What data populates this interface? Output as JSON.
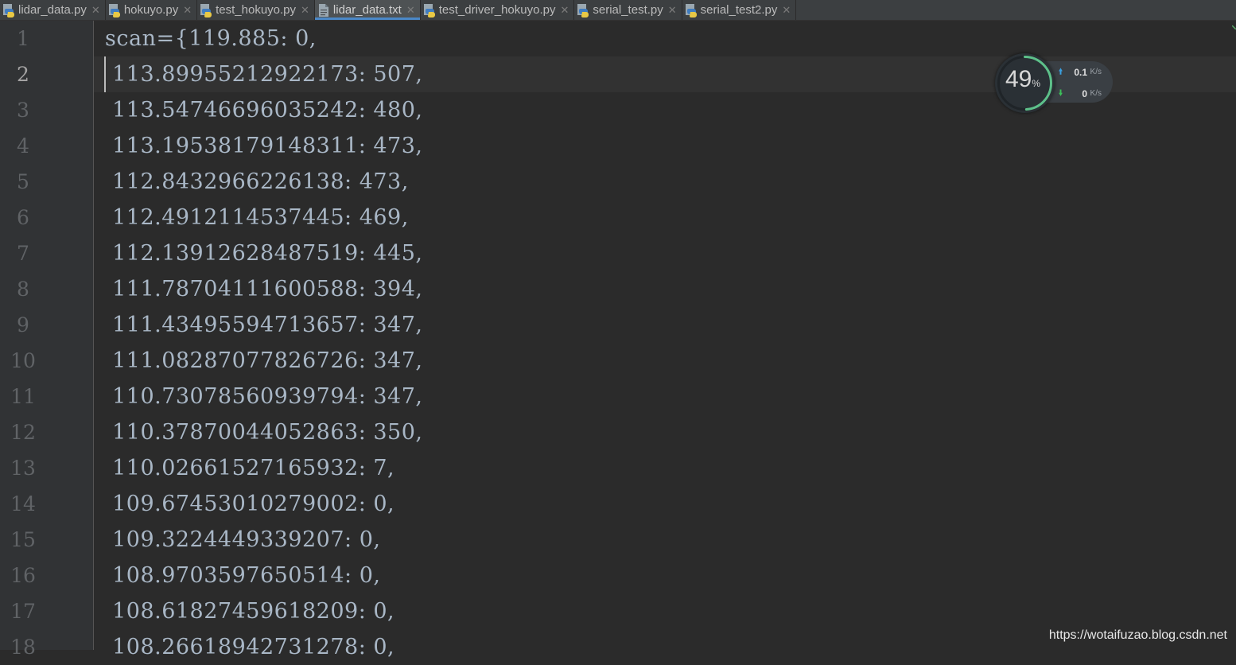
{
  "tabs": [
    {
      "label": "lidar_data.py",
      "icon": "python-file-icon",
      "active": false
    },
    {
      "label": "hokuyo.py",
      "icon": "python-file-icon",
      "active": false
    },
    {
      "label": "test_hokuyo.py",
      "icon": "python-file-icon",
      "active": false
    },
    {
      "label": "lidar_data.txt",
      "icon": "text-file-icon",
      "active": true
    },
    {
      "label": "test_driver_hokuyo.py",
      "icon": "python-file-icon",
      "active": false
    },
    {
      "label": "serial_test.py",
      "icon": "python-file-icon",
      "active": false
    },
    {
      "label": "serial_test2.py",
      "icon": "python-file-icon",
      "active": false
    }
  ],
  "editor": {
    "current_line": 2,
    "lines": [
      {
        "num": "1",
        "text": "scan={119.885: 0,"
      },
      {
        "num": "2",
        "text": " 113.89955212922173: 507,"
      },
      {
        "num": "3",
        "text": " 113.54746696035242: 480,"
      },
      {
        "num": "4",
        "text": " 113.19538179148311: 473,"
      },
      {
        "num": "5",
        "text": " 112.8432966226138: 473,"
      },
      {
        "num": "6",
        "text": " 112.4912114537445: 469,"
      },
      {
        "num": "7",
        "text": " 112.13912628487519: 445,"
      },
      {
        "num": "8",
        "text": " 111.78704111600588: 394,"
      },
      {
        "num": "9",
        "text": " 111.43495594713657: 347,"
      },
      {
        "num": "10",
        "text": " 111.08287077826726: 347,"
      },
      {
        "num": "11",
        "text": " 110.73078560939794: 347,"
      },
      {
        "num": "12",
        "text": " 110.37870044052863: 350,"
      },
      {
        "num": "13",
        "text": " 110.02661527165932: 7,"
      },
      {
        "num": "14",
        "text": " 109.67453010279002: 0,"
      },
      {
        "num": "15",
        "text": " 109.3224449339207: 0,"
      },
      {
        "num": "16",
        "text": " 108.9703597650514: 0,"
      },
      {
        "num": "17",
        "text": " 108.61827459618209: 0,"
      },
      {
        "num": "18",
        "text": " 108.26618942731278: 0,"
      }
    ]
  },
  "network_widget": {
    "percent": "49",
    "percent_unit": "%",
    "upload_value": "0.1",
    "upload_unit": "K/s",
    "download_value": "0",
    "download_unit": "K/s",
    "ring_fraction": 0.49,
    "ring_color": "#5dc08a",
    "upload_color": "#3aa0e0",
    "download_color": "#3cc05a"
  },
  "watermark": "https://wotaifuzao.blog.csdn.net",
  "colors": {
    "editor_bg": "#2b2b2b",
    "gutter_bg": "#313335",
    "tab_active_underline": "#4a88c7",
    "code_text": "#a9b7c6"
  }
}
